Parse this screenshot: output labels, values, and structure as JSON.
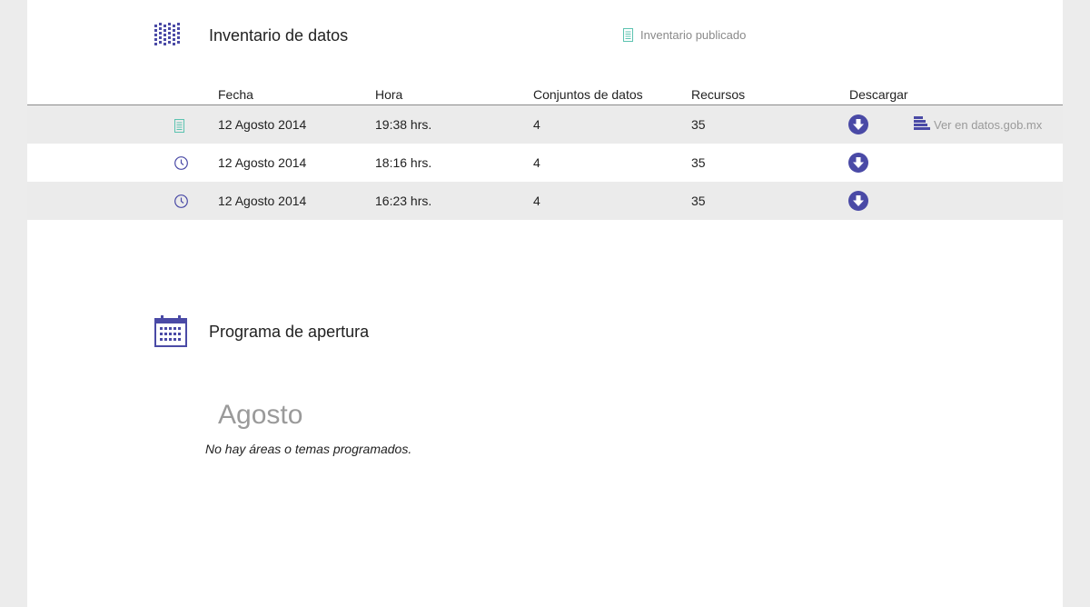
{
  "inventory": {
    "title": "Inventario de datos",
    "published_label": "Inventario publicado",
    "columns": [
      "Fecha",
      "Hora",
      "Conjuntos de datos",
      "Recursos",
      "Descargar"
    ],
    "rows": [
      {
        "status_icon": "document-icon",
        "fecha": "12 Agosto 2014",
        "hora": "19:38 hrs.",
        "conjuntos": "4",
        "recursos": "35",
        "link": "Ver en datos.gob.mx"
      },
      {
        "status_icon": "clock-icon",
        "fecha": "12 Agosto 2014",
        "hora": "18:16 hrs.",
        "conjuntos": "4",
        "recursos": "35"
      },
      {
        "status_icon": "clock-icon",
        "fecha": "12 Agosto 2014",
        "hora": "16:23 hrs.",
        "conjuntos": "4",
        "recursos": "35"
      }
    ]
  },
  "program": {
    "title": "Programa de apertura",
    "month": "Agosto",
    "empty_message": "No hay áreas o temas programados."
  },
  "colors": {
    "accent": "#4a4aa6",
    "published_teal": "#5cc3b0",
    "row_shade": "#ebebeb",
    "muted_text": "#9a9a9a"
  }
}
